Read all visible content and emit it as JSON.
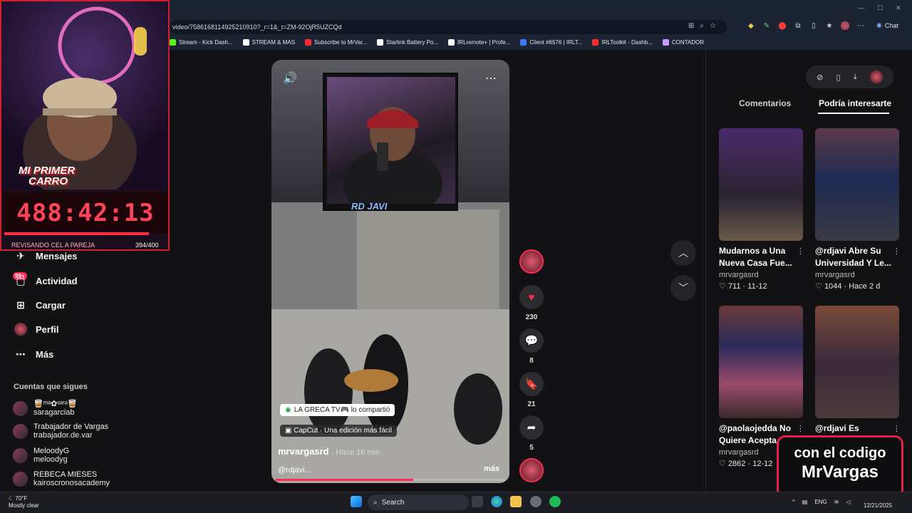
{
  "browser": {
    "url": "video/7586168114925210910?_r=1&_t=ZM-92OjR5UZCQd",
    "bookmarks": [
      {
        "label": "Stream - Kick Dash...",
        "color": "#53fc18"
      },
      {
        "label": "STREAM & MAS",
        "color": "#ffffff"
      },
      {
        "label": "Subscribe to MrVar...",
        "color": "#ff2e2e"
      },
      {
        "label": "Starlink Battery Po...",
        "color": "#ffffff"
      },
      {
        "label": "IRLremote+ | Profe...",
        "color": "#ffffff"
      },
      {
        "label": "Client #6576 | IRLT...",
        "color": "#3b7bff"
      },
      {
        "label": "IRLToolkit - Dashb...",
        "color": "#ff2e2e"
      },
      {
        "label": "CONTADOR",
        "color": "#c99bff"
      }
    ],
    "chat_label": "Chat"
  },
  "stream_overlay": {
    "logo_line1": "MI PRIMER",
    "logo_line2": "CARRO",
    "timer": "488:42:13",
    "progress_label": "REVISANDO CEL A PAREJA",
    "progress_count": "394/400",
    "progress_fraction": 0.985
  },
  "sidebar": {
    "messages_label": "Mensajes",
    "activity_badge": "99+",
    "activity_label": "Actividad",
    "upload_label": "Cargar",
    "profile_label": "Perfil",
    "more_label": "Más",
    "following_title": "Cuentas que sigues",
    "accounts": [
      {
        "name": "🥃️ᵐᵃ✿ˢᵃʳᵃ🥃️",
        "user": "saragarciab"
      },
      {
        "name": "Trabajador de Vargas",
        "user": "trabajador.de.var"
      },
      {
        "name": "MeloodyG",
        "user": "meloodyg"
      },
      {
        "name": "REBECA MIESES",
        "user": "kairoscronosacademy"
      }
    ]
  },
  "video": {
    "inset_label": "RD JAVI",
    "shared_text": "LA GRECA TV🎮 lo compartió",
    "capcut_text": "CapCut · Una edición más fácil",
    "author": "mrvargasrd",
    "time_ago": " · Hace 16 min",
    "caption": "@rdjavi...",
    "more": "más",
    "progress_fraction": 0.6
  },
  "actions": {
    "likes": "230",
    "comments": "8",
    "saves": "21",
    "shares": "5"
  },
  "right_panel": {
    "tab_comments": "Comentarios",
    "tab_suggested": "Podría interesarte",
    "cards": [
      {
        "title": "Mudarnos a Una Nueva Casa Fue...",
        "user": "mrvargasrd",
        "likes": "711",
        "date": "11-12"
      },
      {
        "title": "@rdjavi Abre Su Universidad Y Le...",
        "user": "mrvargasrd",
        "likes": "1044",
        "date": "Hace 2 d"
      },
      {
        "title": "@paolaojedda No Quiere Acepta...",
        "user": "mrvargasrd",
        "likes": "2862",
        "date": "12-12"
      },
      {
        "title": "@rdjavi Es",
        "user": "",
        "likes": "",
        "date": ""
      }
    ]
  },
  "promo": {
    "line1": "con el codigo",
    "line2": "MrVargas"
  },
  "taskbar": {
    "temperature": "70°F",
    "weather": "Mostly clear",
    "search_label": "Search",
    "lang": "ENG",
    "date": "12/21/2025"
  }
}
